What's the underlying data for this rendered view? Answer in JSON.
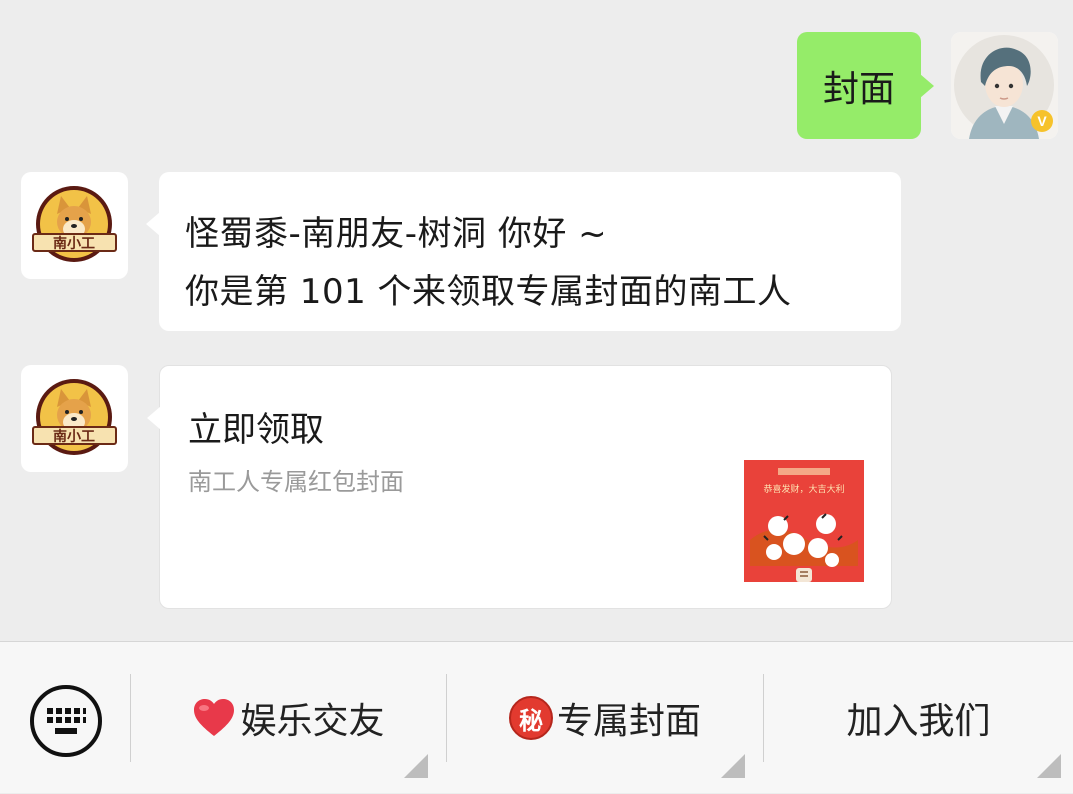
{
  "chat": {
    "outgoing": {
      "text": "封面"
    },
    "incoming_text": {
      "line1": "怪蜀黍-南朋友-树洞 你好 ~",
      "line2": "你是第 101 个来领取专属封面的南工人"
    },
    "card": {
      "title": "立即领取",
      "description": "南工人专属红包封面",
      "thumb_text": "恭喜发财，大吉大利"
    },
    "bot_avatar_label": "南小工",
    "user_badge": "V"
  },
  "menu": {
    "items": [
      {
        "icon": "heart-icon",
        "label": "娱乐交友"
      },
      {
        "icon": "secret-badge-icon",
        "badge_char": "秘",
        "label": "专属封面"
      },
      {
        "label": "加入我们"
      }
    ]
  },
  "colors": {
    "outgoing_bubble": "#95ec69",
    "background": "#ededed",
    "thumb_red": "#e9423a"
  }
}
